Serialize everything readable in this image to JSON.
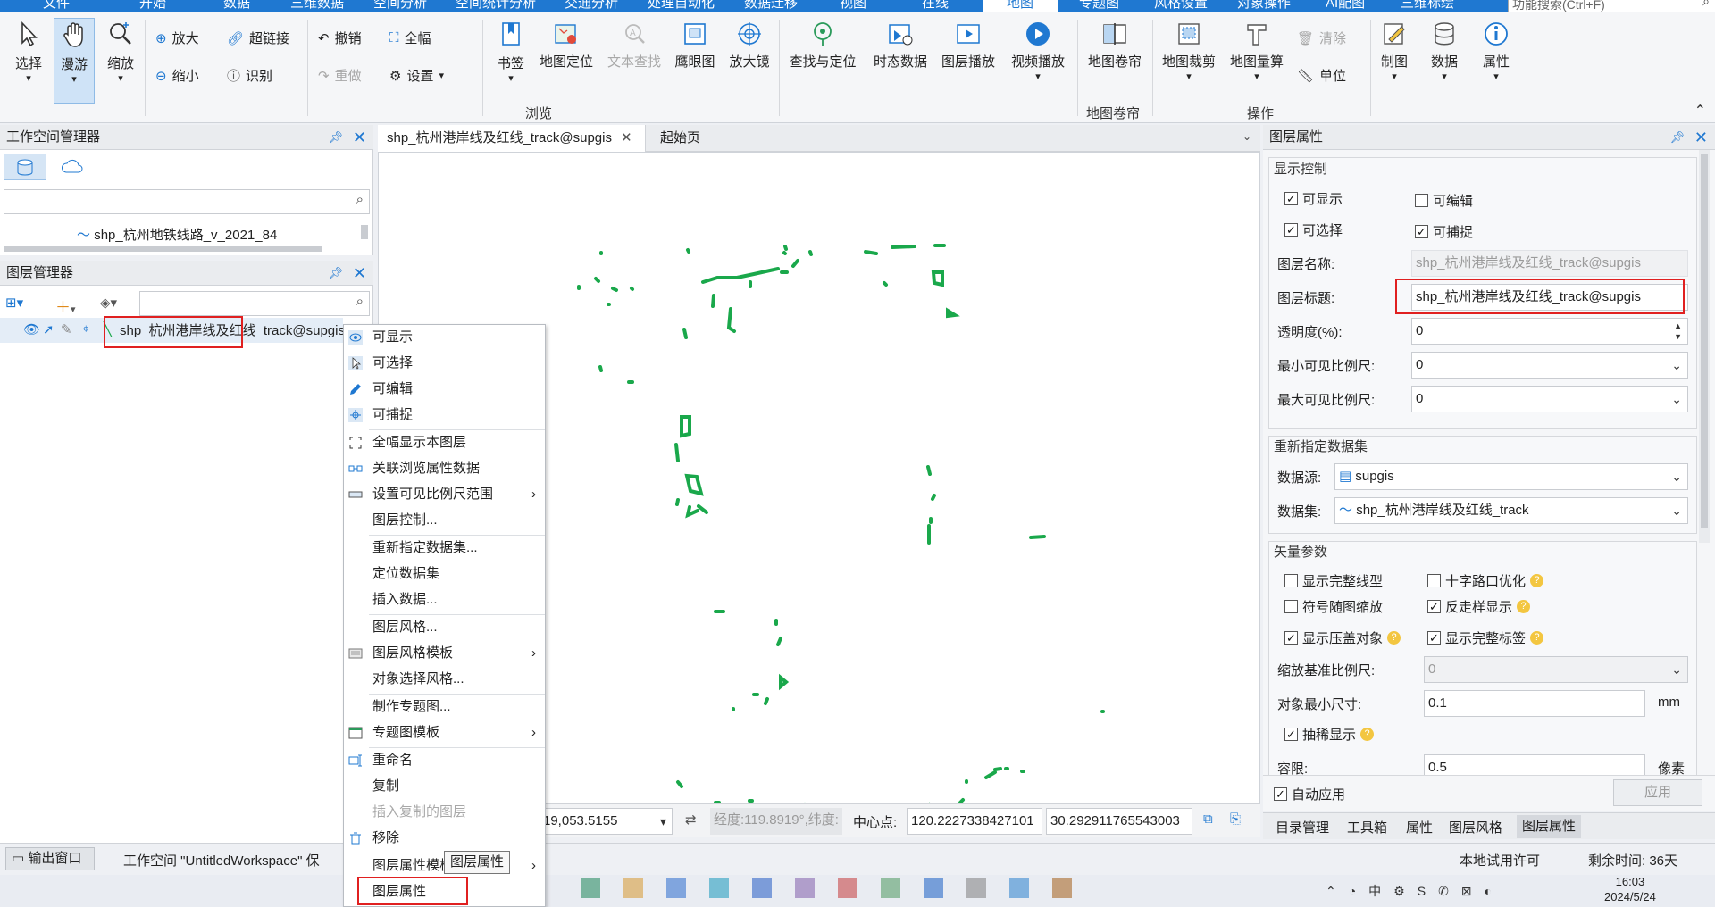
{
  "menubar": {
    "tabs": [
      "文件",
      "开始",
      "数据",
      "三维数据",
      "空间分析",
      "空间统计分析",
      "交通分析",
      "处理自动化",
      "数据迁移",
      "视图",
      "在线",
      "地图",
      "专题图",
      "风格设置",
      "对象操作",
      "AI配图",
      "三维标绘"
    ],
    "active_tab": "地图",
    "search_placeholder": "功能搜索(Ctrl+F)"
  },
  "ribbon": {
    "select": "选择",
    "pan": "漫游",
    "zoom": "缩放",
    "zoom_in": "放大",
    "zoom_out": "缩小",
    "hyperlink": "超链接",
    "identify": "识别",
    "undo": "撤销",
    "redo": "重做",
    "full_extent": "全幅",
    "settings": "设置",
    "bookmark": "书签",
    "map_locate": "地图定位",
    "text_find": "文本查找",
    "overview": "鹰眼图",
    "magnifier": "放大镜",
    "find_locate": "查找与定位",
    "temporal": "时态数据",
    "layer_play": "图层播放",
    "video_play": "视频播放",
    "map_shutter": "地图卷帘",
    "map_clip": "地图裁剪",
    "map_measure": "地图量算",
    "clear": "清除",
    "unit": "单位",
    "cartography": "制图",
    "data": "数据",
    "attribute": "属性",
    "group_browse": "浏览",
    "group_shutter": "地图卷帘",
    "group_ops": "操作"
  },
  "workspace": {
    "title": "工作空间管理器",
    "tree_item": "shp_杭州地铁线路_v_2021_84"
  },
  "layers": {
    "title": "图层管理器",
    "layer_name": "shp_杭州港岸线及红线_track@supgis"
  },
  "tabs": {
    "map_tab": "shp_杭州港岸线及红线_track@supgis",
    "start_tab": "起始页"
  },
  "context_menu": {
    "items": [
      "可显示",
      "可选择",
      "可编辑",
      "可捕捉",
      "全幅显示本图层",
      "关联浏览属性数据",
      "设置可见比例尺范围",
      "图层控制...",
      "重新指定数据集...",
      "定位数据集",
      "插入数据...",
      "图层风格...",
      "图层风格模板",
      "对象选择风格...",
      "制作专题图...",
      "专题图模板",
      "重命名",
      "复制",
      "插入复制的图层",
      "移除",
      "图层属性模板",
      "图层属性"
    ],
    "tooltip": "图层属性"
  },
  "statusbar": {
    "scale_value": "19,053.5155",
    "lonlat": "经度:119.8919°,纬度:",
    "center_label": "中心点:",
    "center_x": "120.2227338427101",
    "center_y": "30.292911765543003",
    "output_window": "输出窗口",
    "workspace_status": "工作空间 \"UntitledWorkspace\" 保",
    "license": "本地试用许可",
    "remaining": "剩余时间: 36天"
  },
  "props": {
    "title": "图层属性",
    "display_control": "显示控制",
    "visible": "可显示",
    "editable": "可编辑",
    "selectable": "可选择",
    "snappable": "可捕捉",
    "layer_name_label": "图层名称:",
    "layer_name": "shp_杭州港岸线及红线_track@supgis",
    "layer_caption_label": "图层标题:",
    "layer_caption": "shp_杭州港岸线及红线_track@supgis",
    "opacity_label": "透明度(%):",
    "opacity": "0",
    "min_scale_label": "最小可见比例尺:",
    "min_scale": "0",
    "max_scale_label": "最大可见比例尺:",
    "max_scale": "0",
    "reassign": "重新指定数据集",
    "datasource_label": "数据源:",
    "datasource": "supgis",
    "dataset_label": "数据集:",
    "dataset": "shp_杭州港岸线及红线_track",
    "vector_params": "矢量参数",
    "full_linetype": "显示完整线型",
    "crossroad": "十字路口优化",
    "symbol_scale": "符号随图缩放",
    "antialias": "反走样显示",
    "show_overlap": "显示压盖对象",
    "full_label": "显示完整标签",
    "ref_scale_label": "缩放基准比例尺:",
    "ref_scale": "0",
    "min_size_label": "对象最小尺寸:",
    "min_size": "0.1",
    "min_size_unit": "mm",
    "thin_display": "抽稀显示",
    "tolerance_label": "容限:",
    "tolerance": "0.5",
    "tolerance_unit": "像素",
    "auto_apply": "自动应用",
    "apply": "应用"
  },
  "bottom_tabs": [
    "目录管理",
    "工具箱",
    "属性",
    "图层风格",
    "图层属性"
  ],
  "clock": {
    "time": "16:03",
    "date": "2024/5/24"
  },
  "colors": {
    "accent": "#1f78d1",
    "track": "#1aa84b",
    "highlight": "#e02020"
  }
}
